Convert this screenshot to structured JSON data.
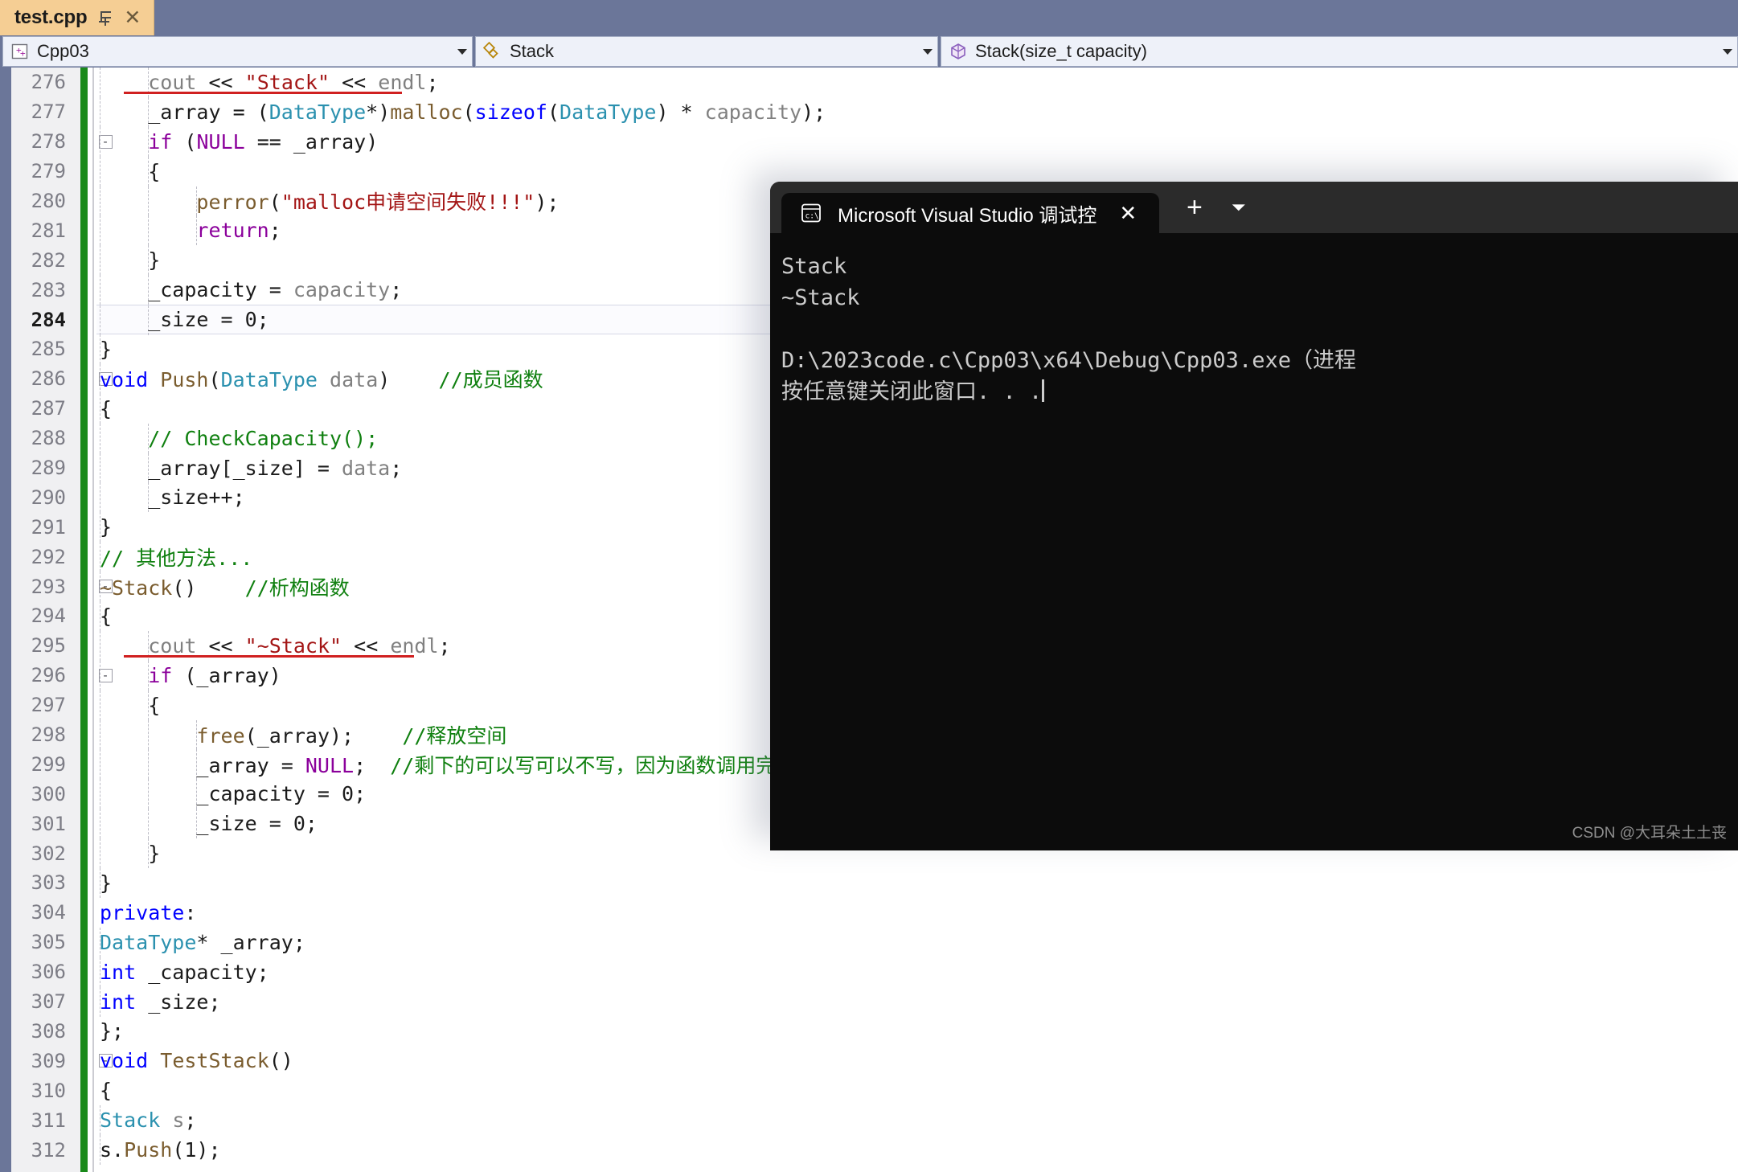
{
  "window": {
    "tab": {
      "title": "test.cpp",
      "pin_icon": "pin-icon",
      "close_icon": "close-icon"
    }
  },
  "navbar": {
    "project": {
      "label": "Cpp03",
      "icon": "cpp-project-icon"
    },
    "type": {
      "label": "Stack",
      "icon": "class-icon"
    },
    "member": {
      "label": "Stack(size_t capacity)",
      "icon": "method-cube-icon"
    },
    "arrow_icon": "chevron-down-icon"
  },
  "editor": {
    "current_line": 284,
    "lines": [
      {
        "n": 276,
        "fold": "",
        "indents": [
          1,
          2
        ],
        "underline": {
          "start": 2,
          "len": 23
        },
        "tokens": [
          {
            "t": "    ",
            "c": "op"
          },
          {
            "t": "cout",
            "c": "v"
          },
          {
            "t": " ",
            "c": "op"
          },
          {
            "t": "<<",
            "c": "op"
          },
          {
            "t": " ",
            "c": "op"
          },
          {
            "t": "\"Stack\"",
            "c": "s"
          },
          {
            "t": " ",
            "c": "op"
          },
          {
            "t": "<<",
            "c": "op"
          },
          {
            "t": " ",
            "c": "op"
          },
          {
            "t": "endl",
            "c": "v"
          },
          {
            "t": ";",
            "c": "op"
          }
        ]
      },
      {
        "n": 277,
        "fold": "",
        "indents": [
          1,
          2
        ],
        "tokens": [
          {
            "t": "    ",
            "c": "op"
          },
          {
            "t": "_array",
            "c": "op"
          },
          {
            "t": " = (",
            "c": "op"
          },
          {
            "t": "DataType",
            "c": "t"
          },
          {
            "t": "*)",
            "c": "op"
          },
          {
            "t": "malloc",
            "c": "f"
          },
          {
            "t": "(",
            "c": "op"
          },
          {
            "t": "sizeof",
            "c": "k"
          },
          {
            "t": "(",
            "c": "op"
          },
          {
            "t": "DataType",
            "c": "t"
          },
          {
            "t": ") * ",
            "c": "op"
          },
          {
            "t": "capacity",
            "c": "v"
          },
          {
            "t": ");",
            "c": "op"
          }
        ]
      },
      {
        "n": 278,
        "fold": "-",
        "indents": [
          1,
          2
        ],
        "tokens": [
          {
            "t": "    ",
            "c": "op"
          },
          {
            "t": "if",
            "c": "kp"
          },
          {
            "t": " (",
            "c": "op"
          },
          {
            "t": "NULL",
            "c": "kp"
          },
          {
            "t": " == ",
            "c": "op"
          },
          {
            "t": "_array",
            "c": "op"
          },
          {
            "t": ")",
            "c": "op"
          }
        ]
      },
      {
        "n": 279,
        "fold": "",
        "indents": [
          1,
          2
        ],
        "tokens": [
          {
            "t": "    {",
            "c": "op"
          }
        ]
      },
      {
        "n": 280,
        "fold": "",
        "indents": [
          1,
          2,
          3
        ],
        "tokens": [
          {
            "t": "        ",
            "c": "op"
          },
          {
            "t": "perror",
            "c": "f"
          },
          {
            "t": "(",
            "c": "op"
          },
          {
            "t": "\"malloc申请空间失败!!!\"",
            "c": "s"
          },
          {
            "t": ");",
            "c": "op"
          }
        ]
      },
      {
        "n": 281,
        "fold": "",
        "indents": [
          1,
          2,
          3
        ],
        "tokens": [
          {
            "t": "        ",
            "c": "op"
          },
          {
            "t": "return",
            "c": "kp"
          },
          {
            "t": ";",
            "c": "op"
          }
        ]
      },
      {
        "n": 282,
        "fold": "",
        "indents": [
          1,
          2
        ],
        "tokens": [
          {
            "t": "    }",
            "c": "op"
          }
        ]
      },
      {
        "n": 283,
        "fold": "",
        "indents": [
          1,
          2
        ],
        "tokens": [
          {
            "t": "    _capacity = ",
            "c": "op"
          },
          {
            "t": "capacity",
            "c": "v"
          },
          {
            "t": ";",
            "c": "op"
          }
        ]
      },
      {
        "n": 284,
        "fold": "",
        "indents": [
          1,
          2
        ],
        "tokens": [
          {
            "t": "    _size = 0;",
            "c": "op"
          }
        ]
      },
      {
        "n": 285,
        "fold": "",
        "indents": [
          1
        ],
        "tokens": [
          {
            "t": "}",
            "c": "op"
          }
        ]
      },
      {
        "n": 286,
        "fold": "-",
        "indents": [
          1
        ],
        "tokens": [
          {
            "t": "void",
            "c": "k"
          },
          {
            "t": " ",
            "c": "op"
          },
          {
            "t": "Push",
            "c": "f"
          },
          {
            "t": "(",
            "c": "op"
          },
          {
            "t": "DataType",
            "c": "t"
          },
          {
            "t": " ",
            "c": "op"
          },
          {
            "t": "data",
            "c": "v"
          },
          {
            "t": ")    ",
            "c": "op"
          },
          {
            "t": "//成员函数",
            "c": "c"
          }
        ]
      },
      {
        "n": 287,
        "fold": "",
        "indents": [
          1
        ],
        "tokens": [
          {
            "t": "{",
            "c": "op"
          }
        ]
      },
      {
        "n": 288,
        "fold": "",
        "indents": [
          1,
          2
        ],
        "tokens": [
          {
            "t": "    ",
            "c": "op"
          },
          {
            "t": "// CheckCapacity();",
            "c": "c"
          }
        ]
      },
      {
        "n": 289,
        "fold": "",
        "indents": [
          1,
          2
        ],
        "tokens": [
          {
            "t": "    _array[_size] = ",
            "c": "op"
          },
          {
            "t": "data",
            "c": "v"
          },
          {
            "t": ";",
            "c": "op"
          }
        ]
      },
      {
        "n": 290,
        "fold": "",
        "indents": [
          1,
          2
        ],
        "tokens": [
          {
            "t": "    _size++;",
            "c": "op"
          }
        ]
      },
      {
        "n": 291,
        "fold": "",
        "indents": [
          1
        ],
        "tokens": [
          {
            "t": "}",
            "c": "op"
          }
        ]
      },
      {
        "n": 292,
        "fold": "",
        "indents": [
          1
        ],
        "tokens": [
          {
            "t": "// 其他方法...",
            "c": "c"
          }
        ]
      },
      {
        "n": 293,
        "fold": "-",
        "indents": [
          1
        ],
        "tokens": [
          {
            "t": "~Stack",
            "c": "f"
          },
          {
            "t": "()    ",
            "c": "op"
          },
          {
            "t": "//析构函数",
            "c": "c"
          }
        ]
      },
      {
        "n": 294,
        "fold": "",
        "indents": [
          1
        ],
        "tokens": [
          {
            "t": "{",
            "c": "op"
          }
        ]
      },
      {
        "n": 295,
        "fold": "",
        "indents": [
          1,
          2
        ],
        "underline": {
          "start": 2,
          "len": 24
        },
        "tokens": [
          {
            "t": "    ",
            "c": "op"
          },
          {
            "t": "cout",
            "c": "v"
          },
          {
            "t": " ",
            "c": "op"
          },
          {
            "t": "<<",
            "c": "op"
          },
          {
            "t": " ",
            "c": "op"
          },
          {
            "t": "\"~Stack\"",
            "c": "s"
          },
          {
            "t": " ",
            "c": "op"
          },
          {
            "t": "<<",
            "c": "op"
          },
          {
            "t": " ",
            "c": "op"
          },
          {
            "t": "endl",
            "c": "v"
          },
          {
            "t": ";",
            "c": "op"
          }
        ]
      },
      {
        "n": 296,
        "fold": "-",
        "indents": [
          1,
          2
        ],
        "tokens": [
          {
            "t": "    ",
            "c": "op"
          },
          {
            "t": "if",
            "c": "kp"
          },
          {
            "t": " (_array)",
            "c": "op"
          }
        ]
      },
      {
        "n": 297,
        "fold": "",
        "indents": [
          1,
          2
        ],
        "tokens": [
          {
            "t": "    {",
            "c": "op"
          }
        ]
      },
      {
        "n": 298,
        "fold": "",
        "indents": [
          1,
          2,
          3
        ],
        "tokens": [
          {
            "t": "        ",
            "c": "op"
          },
          {
            "t": "free",
            "c": "f"
          },
          {
            "t": "(_array);    ",
            "c": "op"
          },
          {
            "t": "//释放空间",
            "c": "c"
          }
        ]
      },
      {
        "n": 299,
        "fold": "",
        "indents": [
          1,
          2,
          3
        ],
        "tokens": [
          {
            "t": "        _array = ",
            "c": "op"
          },
          {
            "t": "NULL",
            "c": "kp"
          },
          {
            "t": ";  ",
            "c": "op"
          },
          {
            "t": "//剩下的可以写可以不写，因为函数调用完成会自动回",
            "c": "c"
          }
        ]
      },
      {
        "n": 300,
        "fold": "",
        "indents": [
          1,
          2,
          3
        ],
        "tokens": [
          {
            "t": "        _capacity = 0;",
            "c": "op"
          }
        ]
      },
      {
        "n": 301,
        "fold": "",
        "indents": [
          1,
          2,
          3
        ],
        "tokens": [
          {
            "t": "        _size = 0;",
            "c": "op"
          }
        ]
      },
      {
        "n": 302,
        "fold": "",
        "indents": [
          1,
          2
        ],
        "tokens": [
          {
            "t": "    }",
            "c": "op"
          }
        ]
      },
      {
        "n": 303,
        "fold": "",
        "indents": [
          1
        ],
        "tokens": [
          {
            "t": "}",
            "c": "op"
          }
        ]
      },
      {
        "n": 304,
        "fold": "",
        "indents": [],
        "tokens": [
          {
            "t": "private",
            "c": "k"
          },
          {
            "t": ":",
            "c": "op"
          }
        ]
      },
      {
        "n": 305,
        "fold": "",
        "indents": [
          1
        ],
        "tokens": [
          {
            "t": "DataType",
            "c": "t"
          },
          {
            "t": "* _array;",
            "c": "op"
          }
        ]
      },
      {
        "n": 306,
        "fold": "",
        "indents": [
          1
        ],
        "tokens": [
          {
            "t": "int",
            "c": "k"
          },
          {
            "t": " _capacity;",
            "c": "op"
          }
        ]
      },
      {
        "n": 307,
        "fold": "",
        "indents": [
          1
        ],
        "tokens": [
          {
            "t": "int",
            "c": "k"
          },
          {
            "t": " _size;",
            "c": "op"
          }
        ]
      },
      {
        "n": 308,
        "fold": "",
        "indents": [],
        "tokens": [
          {
            "t": "};",
            "c": "op"
          }
        ]
      },
      {
        "n": 309,
        "fold": "-",
        "indents": [],
        "tokens": [
          {
            "t": "void",
            "c": "k"
          },
          {
            "t": " ",
            "c": "op"
          },
          {
            "t": "TestStack",
            "c": "f"
          },
          {
            "t": "()",
            "c": "op"
          }
        ]
      },
      {
        "n": 310,
        "fold": "",
        "indents": [],
        "tokens": [
          {
            "t": "{",
            "c": "op"
          }
        ]
      },
      {
        "n": 311,
        "fold": "",
        "indents": [
          1
        ],
        "tokens": [
          {
            "t": "Stack",
            "c": "t"
          },
          {
            "t": " ",
            "c": "op"
          },
          {
            "t": "s",
            "c": "v"
          },
          {
            "t": ";",
            "c": "op"
          }
        ]
      },
      {
        "n": 312,
        "fold": "",
        "indents": [
          1
        ],
        "tokens": [
          {
            "t": "s.",
            "c": "op"
          },
          {
            "t": "Push",
            "c": "f"
          },
          {
            "t": "(1);",
            "c": "op"
          }
        ]
      }
    ]
  },
  "terminal": {
    "tab_title": "Microsoft Visual Studio 调试控",
    "tab_icon": "console-icon",
    "close_icon": "close-icon",
    "new_tab_icon": "plus-icon",
    "dropdown_icon": "chevron-down-icon",
    "output": [
      "Stack",
      "~Stack",
      "",
      "D:\\2023code.c\\Cpp03\\x64\\Debug\\Cpp03.exe（进程",
      "按任意键关闭此窗口. . ."
    ],
    "watermark": "CSDN @大耳朵土土丧"
  },
  "colors": {
    "tab_active_bg": "#f5ce94",
    "chrome_bg": "#6b7699",
    "gutter_bg": "#f0f0f2",
    "change_bar": "#1a8a1a",
    "terminal_bg": "#0c0c0c",
    "terminal_title_bg": "#2b2b2b",
    "underline_red": "#d02020"
  }
}
